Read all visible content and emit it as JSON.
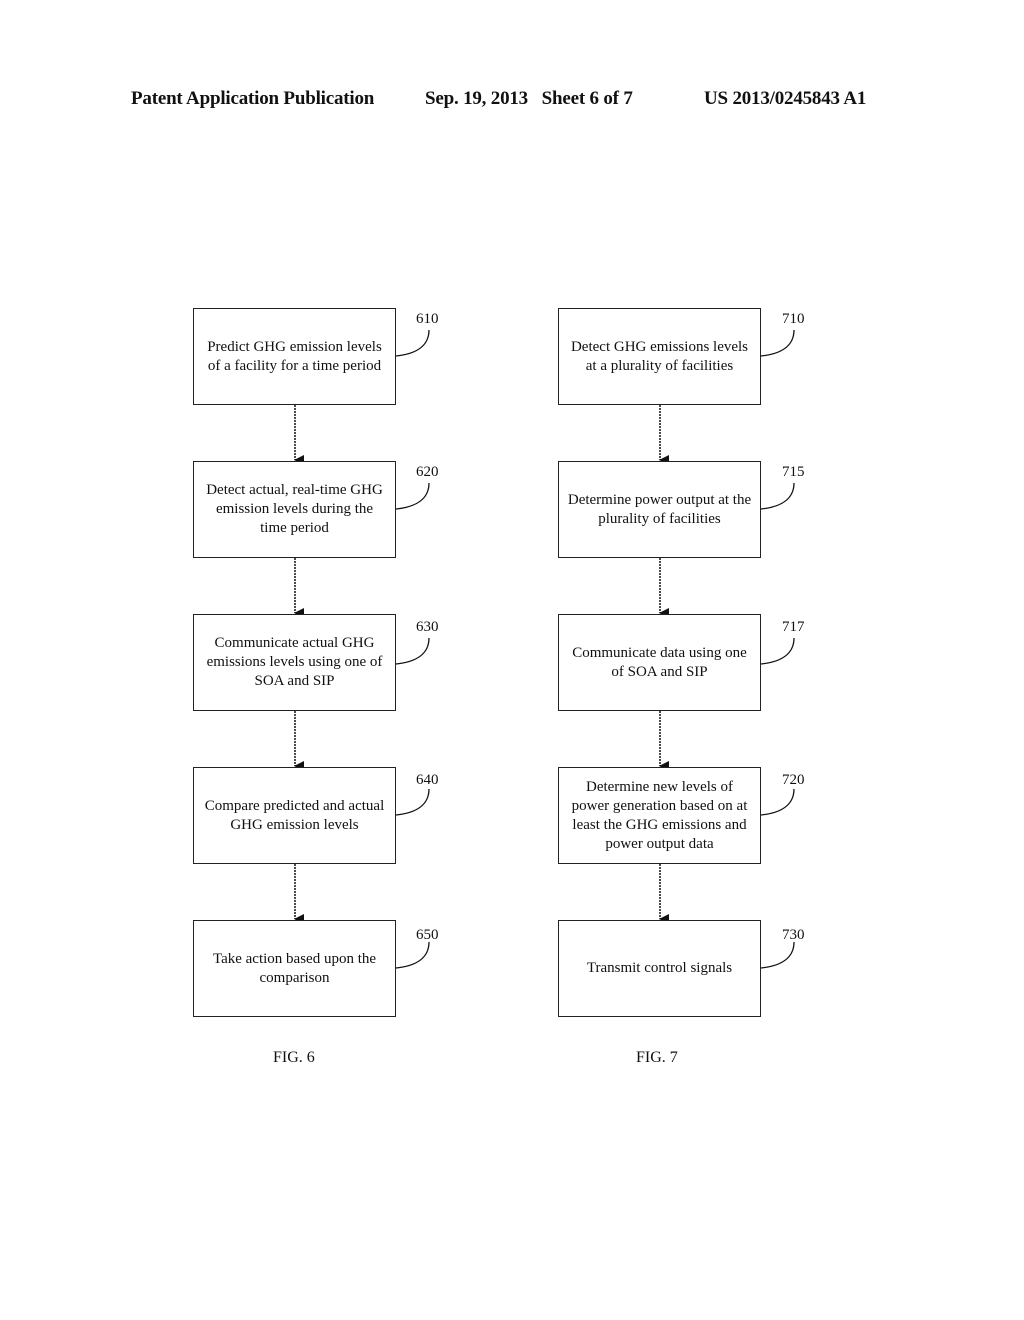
{
  "header": {
    "left": "Patent Application Publication",
    "middle": "Sep. 19, 2013   Sheet 6 of 7",
    "right": "US 2013/0245843 A1"
  },
  "figures": [
    {
      "label": "FIG. 6",
      "steps": [
        {
          "ref": "610",
          "text": "Predict GHG emission levels of a facility for a time period"
        },
        {
          "ref": "620",
          "text": "Detect actual, real-time GHG emission levels during the time period"
        },
        {
          "ref": "630",
          "text": "Communicate actual GHG emissions levels using one of SOA and SIP"
        },
        {
          "ref": "640",
          "text": "Compare predicted and actual GHG emission levels"
        },
        {
          "ref": "650",
          "text": "Take action based upon the comparison"
        }
      ]
    },
    {
      "label": "FIG. 7",
      "steps": [
        {
          "ref": "710",
          "text": "Detect GHG emissions levels at a plurality of facilities"
        },
        {
          "ref": "715",
          "text": "Determine power output at the plurality of facilities"
        },
        {
          "ref": "717",
          "text": "Communicate data using one of SOA and SIP"
        },
        {
          "ref": "720",
          "text": "Determine new levels of power generation based on at least the GHG emissions and power output data"
        },
        {
          "ref": "730",
          "text": "Transmit control signals"
        }
      ]
    }
  ]
}
